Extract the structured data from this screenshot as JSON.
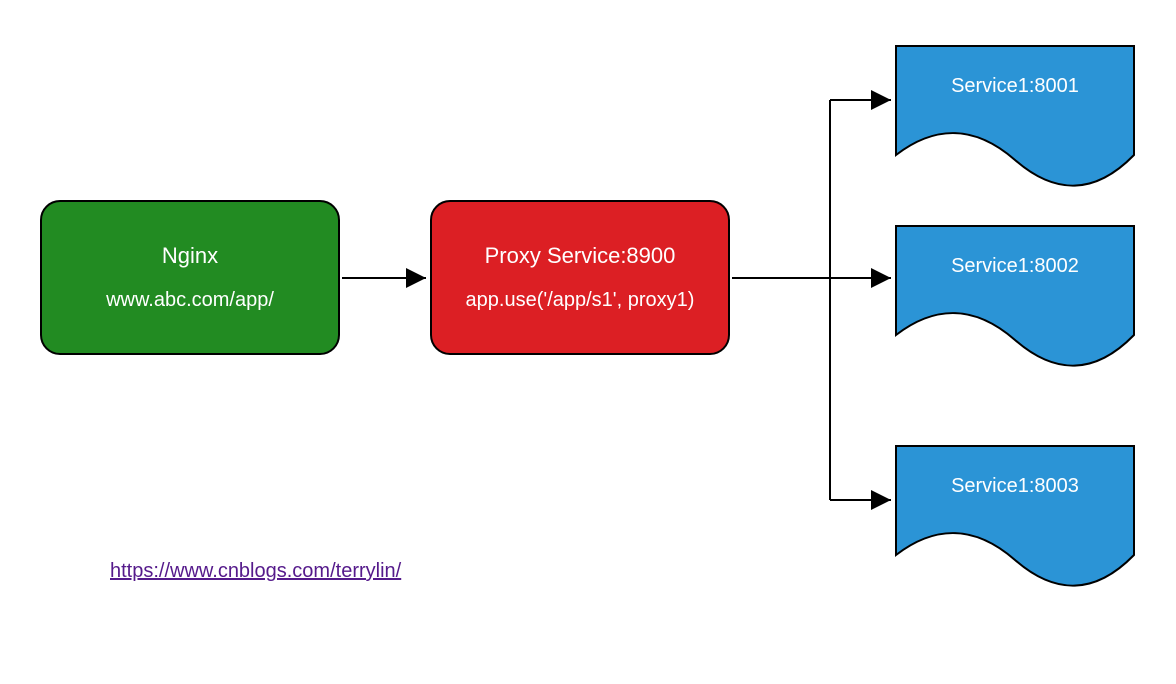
{
  "nginx": {
    "title": "Nginx",
    "sub": "www.abc.com/app/"
  },
  "proxy": {
    "title": "Proxy Service:8900",
    "sub": "app.use('/app/s1', proxy1)"
  },
  "services": {
    "s1": "Service1:8001",
    "s2": "Service1:8002",
    "s3": "Service1:8003"
  },
  "link": {
    "text": "https://www.cnblogs.com/terrylin/"
  },
  "colors": {
    "nginx": "#228B22",
    "proxy": "#DC1F24",
    "service": "#2B94D6",
    "link": "#551A8B"
  }
}
